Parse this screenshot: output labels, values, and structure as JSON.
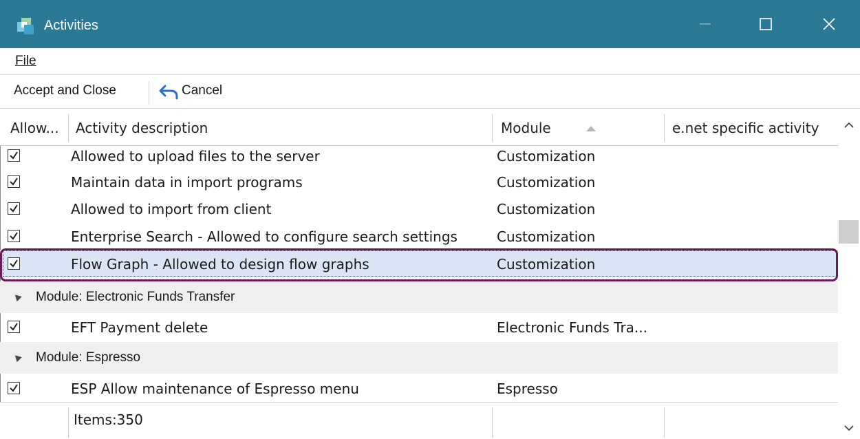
{
  "window": {
    "title": "Activities",
    "controls": {
      "minimize": "—",
      "maximize": "□",
      "close": "✕"
    }
  },
  "menu": {
    "file_label": "File"
  },
  "toolbar": {
    "accept_label": "Accept and Close",
    "cancel_label": "Cancel"
  },
  "columns": {
    "allow": "Allow...",
    "description": "Activity description",
    "module": "Module",
    "enet": "e.net specific activity",
    "module_sort": "ascending"
  },
  "rows": [
    {
      "type": "activity",
      "checked": true,
      "description": "Allowed to upload files to the server",
      "module": "Customization"
    },
    {
      "type": "activity",
      "checked": true,
      "description": "Maintain data in import programs",
      "module": "Customization"
    },
    {
      "type": "activity",
      "checked": true,
      "description": "Allowed to import from client",
      "module": "Customization"
    },
    {
      "type": "activity",
      "checked": true,
      "description": "Enterprise Search - Allowed to configure search settings",
      "module": "Customization"
    },
    {
      "type": "activity",
      "checked": true,
      "selected": true,
      "description": "Flow Graph - Allowed to design flow graphs",
      "module": "Customization"
    },
    {
      "type": "group",
      "label": "Module: Electronic Funds Transfer"
    },
    {
      "type": "activity",
      "checked": true,
      "description": "EFT Payment delete",
      "module": "Electronic Funds Tra..."
    },
    {
      "type": "group",
      "label": "Module: Espresso"
    },
    {
      "type": "activity",
      "checked": true,
      "description": "ESP Allow maintenance of Espresso menu",
      "module": "Espresso"
    }
  ],
  "footer": {
    "items_count": "Items:350"
  },
  "colors": {
    "titlebar": "#2b7a95",
    "selection": "#dbe5f5",
    "highlight": "#6b1a5c",
    "group_bg": "#efefef"
  },
  "scrollbar": {
    "up_icon": "chevron-up-icon",
    "down_icon": "chevron-down-icon"
  }
}
